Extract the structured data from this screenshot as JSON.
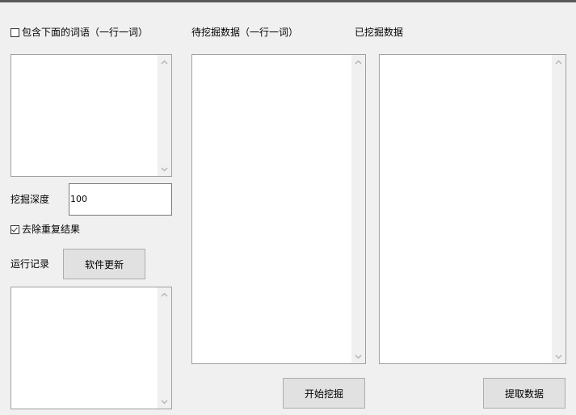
{
  "left_panel": {
    "include_words_checkbox": {
      "label": "包含下面的词语（一行一词）",
      "checked": false
    },
    "depth_label": "挖掘深度",
    "depth_value": "100",
    "dedupe_checkbox": {
      "label": "去除重复结果",
      "checked": true
    },
    "log_label": "运行记录",
    "update_button": "软件更新"
  },
  "middle_panel": {
    "title": "待挖掘数据（一行一词）",
    "start_button": "开始挖掘"
  },
  "right_panel": {
    "title": "已挖掘数据",
    "extract_button": "提取数据"
  },
  "icons": {
    "scroll_up": "chevron-up-icon",
    "scroll_down": "chevron-down-icon"
  },
  "colors": {
    "window_bg": "#f0f0f0",
    "button_bg": "#e1e1e1",
    "top_bar": "#5a5a5a"
  }
}
